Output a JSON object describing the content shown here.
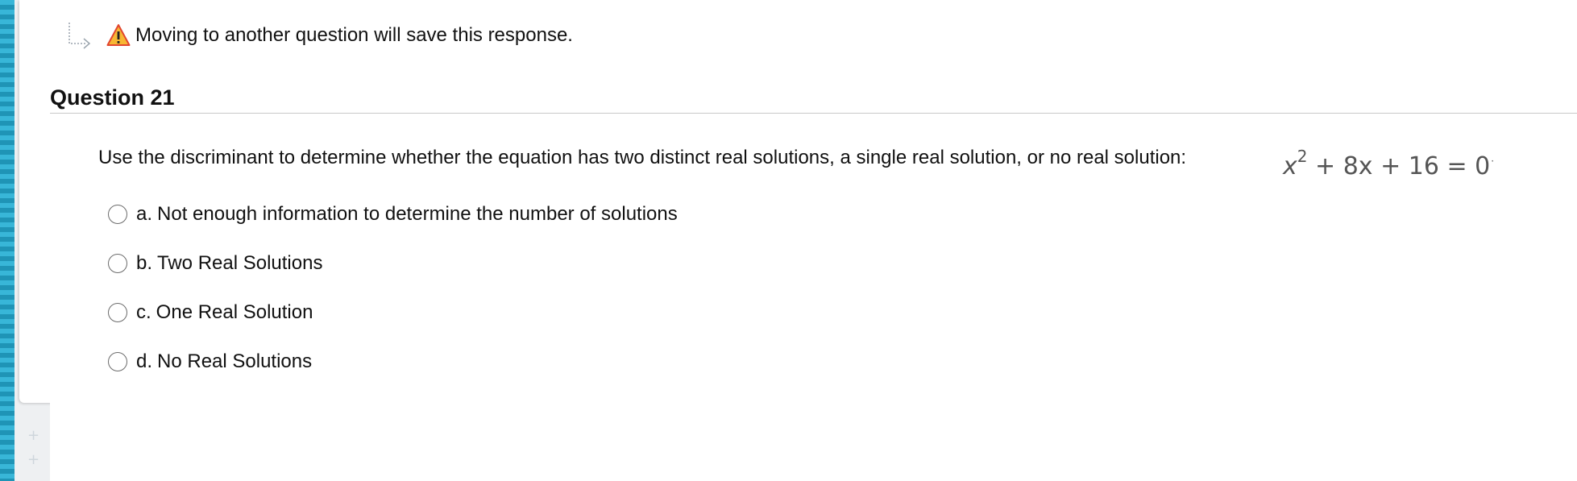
{
  "notice": {
    "icon": "warning-icon",
    "text": "Moving to another question will save this response."
  },
  "question": {
    "title": "Question 21",
    "prompt": "Use the discriminant to determine whether the equation has two distinct real solutions, a single real solution, or no real solution:",
    "equation": {
      "base": "x",
      "exponent": "2",
      "rest": " + 8x + 16 = 0"
    }
  },
  "options": [
    {
      "letter": "a.",
      "label": "Not enough information to determine the number of solutions"
    },
    {
      "letter": "b.",
      "label": "Two Real Solutions"
    },
    {
      "letter": "c.",
      "label": "One Real Solution"
    },
    {
      "letter": "d.",
      "label": "No Real Solutions"
    }
  ],
  "colors": {
    "stripe": "#2aa6c8",
    "warning": "#f5a623",
    "rule": "#c8c8c8"
  }
}
